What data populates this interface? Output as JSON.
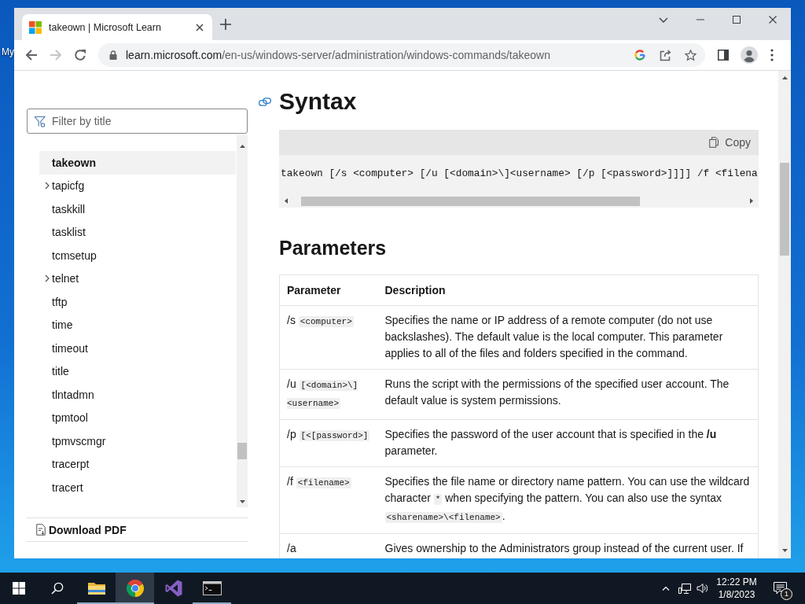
{
  "desktop": {
    "icon_label": "My"
  },
  "browser": {
    "tabs": [
      {
        "title": "takeown | Microsoft Learn",
        "selected": true
      }
    ],
    "nav_buttons": [
      {
        "kind": "back",
        "disabled": false
      },
      {
        "kind": "forward",
        "disabled": true
      },
      {
        "kind": "reload",
        "disabled": false
      }
    ],
    "address": {
      "host": "learn.microsoft.com",
      "path": "/en-us/windows-server/administration/windows-commands/takeown"
    }
  },
  "sidebar": {
    "filter": {
      "placeholder": "Filter by title"
    },
    "items": [
      {
        "label": "takeown",
        "selected": true,
        "expandable": false
      },
      {
        "label": "tapicfg",
        "selected": false,
        "expandable": true
      },
      {
        "label": "taskkill",
        "selected": false,
        "expandable": false
      },
      {
        "label": "tasklist",
        "selected": false,
        "expandable": false
      },
      {
        "label": "tcmsetup",
        "selected": false,
        "expandable": false
      },
      {
        "label": "telnet",
        "selected": false,
        "expandable": true
      },
      {
        "label": "tftp",
        "selected": false,
        "expandable": false
      },
      {
        "label": "time",
        "selected": false,
        "expandable": false
      },
      {
        "label": "timeout",
        "selected": false,
        "expandable": false
      },
      {
        "label": "title",
        "selected": false,
        "expandable": false
      },
      {
        "label": "tlntadmn",
        "selected": false,
        "expandable": false
      },
      {
        "label": "tpmtool",
        "selected": false,
        "expandable": false
      },
      {
        "label": "tpmvscmgr",
        "selected": false,
        "expandable": false
      },
      {
        "label": "tracerpt",
        "selected": false,
        "expandable": false
      },
      {
        "label": "tracert",
        "selected": false,
        "expandable": false
      }
    ],
    "download_label": "Download PDF"
  },
  "article": {
    "syntax": {
      "heading": "Syntax",
      "copy_label": "Copy",
      "code": "takeown [/s <computer> [/u [<domain>\\]<username> [/p [<password>]]]] /f <filena"
    },
    "parameters": {
      "heading": "Parameters",
      "columns": [
        "Parameter",
        "Description"
      ],
      "rows": [
        {
          "parameter": {
            "flag": "/s",
            "arg": "<computer>"
          },
          "description": [
            {
              "kind": "text",
              "text": "Specifies the name or IP address of a remote computer (do not use backslashes). The default value is the local computer. This parameter applies to all of the files and folders specified in the command."
            }
          ]
        },
        {
          "parameter": {
            "flag": "/u",
            "arg": "[<domain>\\]<username>"
          },
          "description": [
            {
              "kind": "text",
              "text": "Runs the script with the permissions of the specified user account. The default value is system permissions."
            }
          ]
        },
        {
          "parameter": {
            "flag": "/p",
            "arg": "[<[password>]"
          },
          "description": [
            {
              "kind": "text",
              "text": "Specifies the password of the user account that is specified in the **/u** parameter."
            }
          ]
        },
        {
          "parameter": {
            "flag": "/f",
            "arg": "<filename>"
          },
          "description": [
            {
              "kind": "text",
              "text": "Specifies the file name or directory name pattern. You can use the wildcard character "
            },
            {
              "kind": "code",
              "text": "*"
            },
            {
              "kind": "text",
              "text": " when specifying the pattern. You can also use the syntax "
            },
            {
              "kind": "code",
              "text": "<sharename>\\<filename>"
            },
            {
              "kind": "text",
              "text": "."
            }
          ]
        },
        {
          "parameter": {
            "flag": "/a"
          },
          "description": [
            {
              "kind": "text",
              "text": "Gives ownership to the Administrators group instead of the current user. If"
            }
          ]
        }
      ]
    }
  },
  "taskbar": {
    "apps": [
      {
        "kind": "folder",
        "running": true,
        "selected": false
      },
      {
        "kind": "browser",
        "running": true,
        "selected": true
      },
      {
        "kind": "editor",
        "running": false,
        "selected": false
      },
      {
        "kind": "terminal",
        "running": true,
        "selected": false
      }
    ],
    "clock": {
      "time": "12:22 PM",
      "date": "1/8/2023"
    },
    "notification_count": "1"
  }
}
